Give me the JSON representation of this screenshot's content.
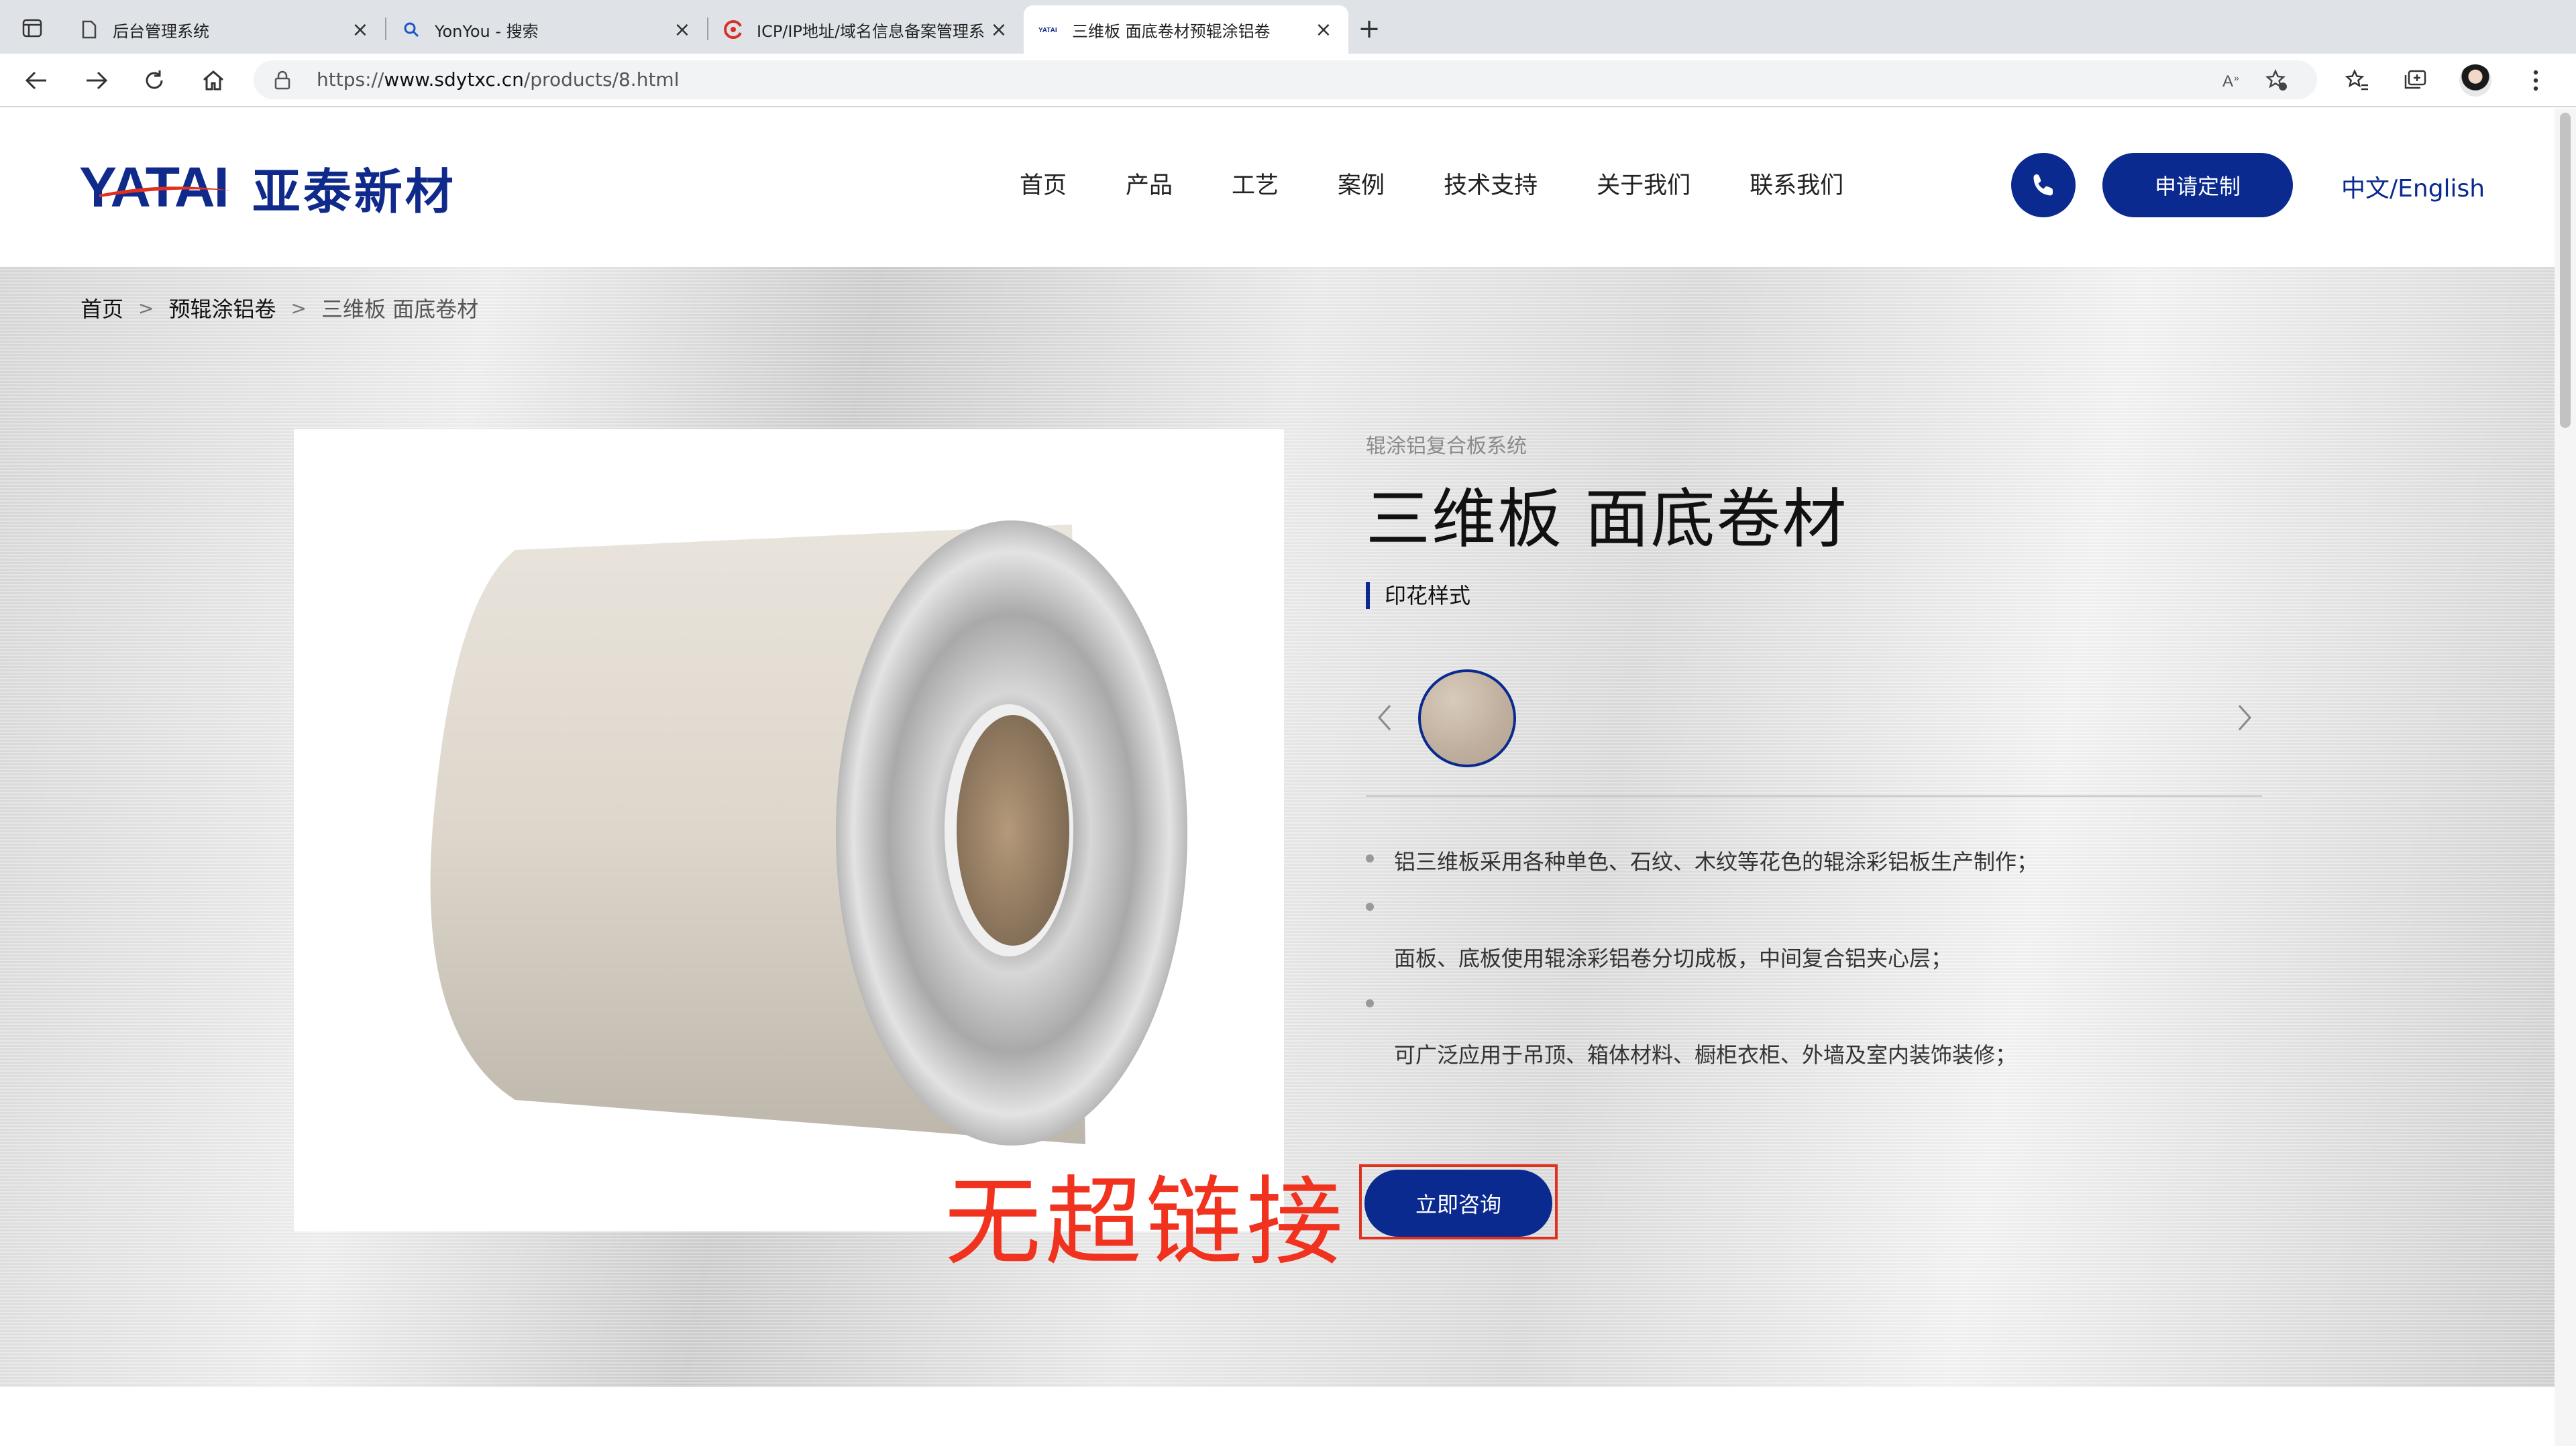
{
  "browser": {
    "tabs": [
      {
        "title": "后台管理系统",
        "icon": "page-icon"
      },
      {
        "title": "YonYou - 搜索",
        "icon": "search-icon"
      },
      {
        "title": "ICP/IP地址/域名信息备案管理系",
        "icon": "miit-icon"
      },
      {
        "title": "三维板 面底卷材预辊涂铝卷",
        "icon": "yatai-icon",
        "active": true
      }
    ],
    "url_prefix": "https://",
    "url_domain": "www.sdytxc.cn",
    "url_path": "/products/8.html"
  },
  "site": {
    "logo_latin": "YATAI",
    "logo_cn": "亚泰新材",
    "nav": [
      "首页",
      "产品",
      "工艺",
      "案例",
      "技术支持",
      "关于我们",
      "联系我们"
    ],
    "custom_button": "申请定制",
    "language": "中文/English",
    "brand_color": "#0b2a8f"
  },
  "breadcrumb": {
    "home": "首页",
    "category": "预辊涂铝卷",
    "current": "三维板 面底卷材",
    "separator": ">"
  },
  "product": {
    "series": "辊涂铝复合板系统",
    "title": "三维板 面底卷材",
    "pattern_label": "印花样式",
    "features": [
      "铝三维板采用各种单色、石纹、木纹等花色的辊涂彩铝板生产制作；",
      "面板、底板使用辊涂彩铝卷分切成板，中间复合铝夹心层；",
      "可广泛应用于吊顶、箱体材料、橱柜衣柜、外墙及室内装饰装修；"
    ],
    "consult_button": "立即咨询"
  },
  "annotation": {
    "text": "无超链接",
    "color": "#f0321e"
  }
}
